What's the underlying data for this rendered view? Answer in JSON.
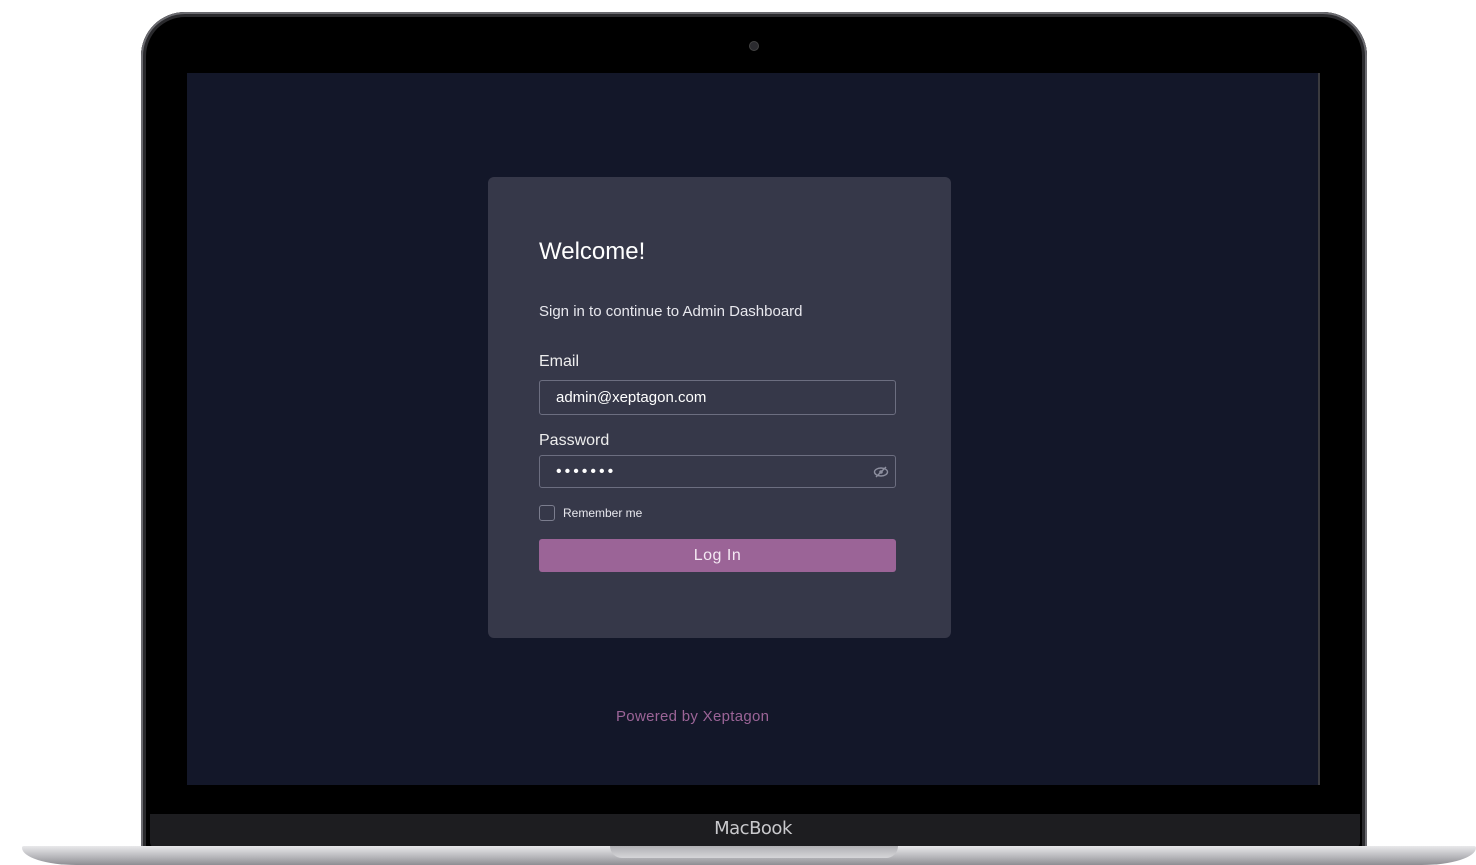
{
  "device": {
    "brand_label": "MacBook"
  },
  "login": {
    "title": "Welcome!",
    "subtitle": "Sign in to continue to Admin Dashboard",
    "email_label": "Email",
    "email_value": "admin@xeptagon.com",
    "password_label": "Password",
    "password_value": "•••••••",
    "password_toggle_icon": "eye-slash-icon",
    "remember_label": "Remember me",
    "remember_checked": false,
    "submit_label": "Log In"
  },
  "footer": {
    "powered_by": "Powered by Xeptagon"
  },
  "colors": {
    "screen_bg": "#131729",
    "card_bg": "#363849",
    "accent": "#9b6497"
  }
}
